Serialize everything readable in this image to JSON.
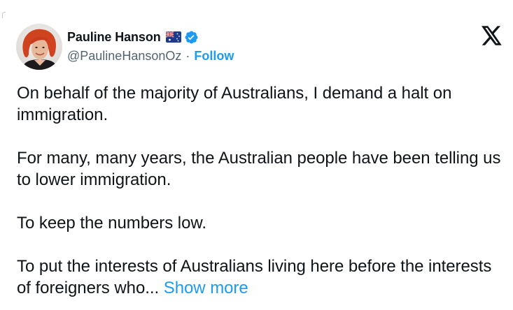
{
  "author": {
    "display_name": "Pauline Hanson",
    "flag_icon": "australia-flag-icon",
    "verified_icon": "verified-badge-icon",
    "verified_color": "#1d9bf0",
    "handle": "@PaulineHansonOz",
    "separator": "·",
    "follow_label": "Follow"
  },
  "brand": {
    "logo_icon": "x-logo-icon"
  },
  "tweet": {
    "paragraphs": [
      "On behalf of the majority of Australians, I demand a halt on immigration.",
      "For many, many years, the Australian people have been telling us to lower immigration.",
      "To keep the numbers low."
    ],
    "last_paragraph": "To put the interests of Australians living here before the interests of foreigners who...",
    "show_more_label": "Show more"
  },
  "colors": {
    "text": "#0f1419",
    "secondary": "#536471",
    "accent": "#1d9bf0"
  }
}
